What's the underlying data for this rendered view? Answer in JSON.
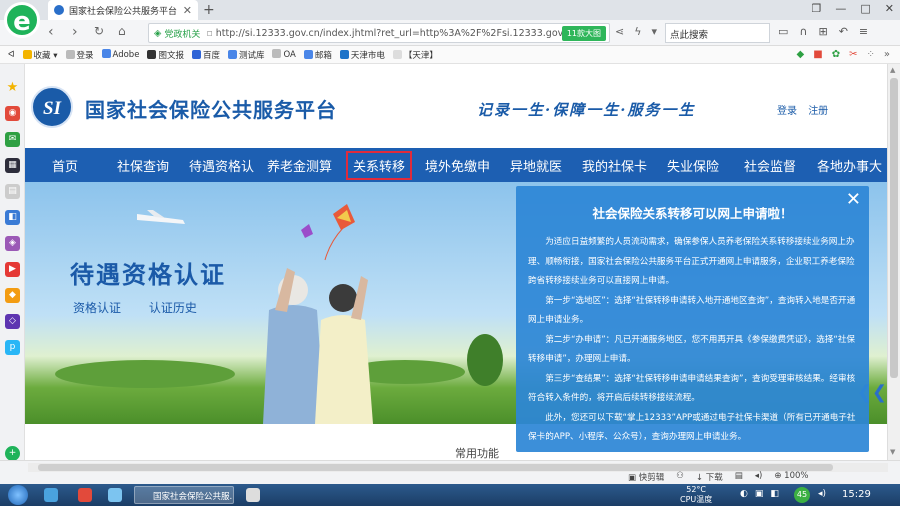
{
  "browser": {
    "tab_title": "国家社会保险公共服务平台",
    "url_badge_left": "党政机关",
    "url": "http://si.12333.gov.cn/index.jhtml?ret_url=http%3A%2F%2Fsi.12333.gov.c",
    "url_badge": "11款大图",
    "search_placeholder": "点此搜索",
    "bookmarks": [
      "收藏",
      "登录",
      "Adobe",
      "图文报",
      "百度",
      "测试库",
      "OA",
      "邮箱",
      "天津市电",
      "【天津】"
    ],
    "status_items": [
      "快剪辑",
      "下载",
      "100%"
    ]
  },
  "site": {
    "logo_text": "SI",
    "title": "国家社会保险公共服务平台",
    "slogan": "记录一生·保障一生·服务一生",
    "login": "登录",
    "register": "注册"
  },
  "nav": [
    "首页",
    "社保查询",
    "待遇资格认",
    "养老金测算",
    "关系转移",
    "境外免缴申",
    "异地就医",
    "我的社保卡",
    "失业保险",
    "社会监督",
    "各地办事大"
  ],
  "banner": {
    "title": "待遇资格认证",
    "links": [
      "资格认证",
      "认证历史"
    ]
  },
  "below_text": "常用功能",
  "popup": {
    "title": "社会保险关系转移可以网上申请啦！",
    "paragraphs": [
      "为适应日益频繁的人员流动需求，确保参保人员养老保险关系转移接续业务网上办理、顺畅衔接，国家社会保险公共服务平台正式开通网上申请服务，企业职工养老保险跨省转移接续业务可以直接网上申请。",
      "第一步“选地区”：选择“社保转移申请转入地开通地区查询”，查询转入地是否开通网上申请业务。",
      "第二步“办申请”：凡已开通服务地区，您不用再开具《参保缴费凭证》，选择“社保转移申请”，办理网上申请。",
      "第三步“查结果”：选择“社保转移申请申请结果查询”，查询受理审核结果。经审核符合转入条件的，将开启后续转移接续流程。",
      "此外，您还可以下载“掌上12333”APP或通过电子社保卡渠道（所有已开通电子社保卡的APP、小程序、公众号），查询办理网上申请业务。"
    ]
  },
  "taskbar": {
    "task_label": "国家社会保险公共服...",
    "temp": "52°C",
    "temp_label": "CPU温度",
    "badge": "45",
    "clock": "15:29"
  }
}
